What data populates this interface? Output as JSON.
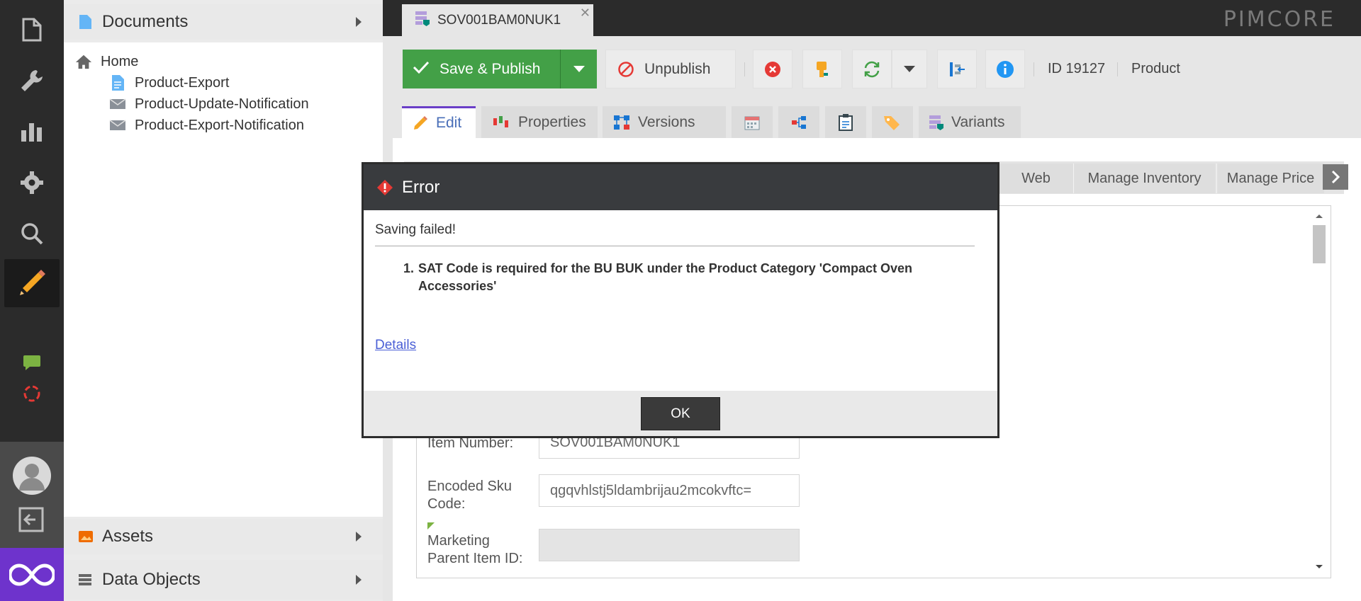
{
  "tree": {
    "documents_label": "Documents",
    "items": [
      {
        "label": "Home"
      },
      {
        "label": "Product-Export"
      },
      {
        "label": "Product-Update-Notification"
      },
      {
        "label": "Product-Export-Notification"
      }
    ],
    "assets_label": "Assets",
    "data_objects_label": "Data Objects"
  },
  "tab": {
    "title": "SOV001BAM0NUK1"
  },
  "brand": "PIMCORE",
  "toolbar": {
    "save_label": "Save & Publish",
    "unpublish_label": "Unpublish",
    "id_text": "ID 19127",
    "type_text": "Product"
  },
  "subtabs": {
    "edit": "Edit",
    "properties": "Properties",
    "versions": "Versions",
    "variants": "Variants"
  },
  "classtabs": {
    "web": "Web",
    "manage_inventory": "Manage Inventory",
    "manage_price": "Manage Price"
  },
  "form": {
    "item_number_label": "Item Number:",
    "item_number_value": "SOV001BAM0NUK1",
    "encoded_sku_label_1": "Encoded Sku",
    "encoded_sku_label_2": "Code:",
    "encoded_sku_value": "qgqvhlstj5ldambrijau2mcokvftc=",
    "marketing_label_1": "Marketing",
    "marketing_label_2": "Parent Item ID:",
    "marketing_value": ""
  },
  "dialog": {
    "title": "Error",
    "message": "Saving failed!",
    "error_number": "1.",
    "error_text": "SAT Code is required for the BU BUK under the Product Category 'Compact Oven Accessories'",
    "details_link": "Details",
    "ok_label": "OK"
  },
  "colors": {
    "accent_green": "#43a047",
    "dialog_header": "#393b3e",
    "brand_purple": "#6e33cc",
    "active_tab": "#6a3ec7"
  }
}
